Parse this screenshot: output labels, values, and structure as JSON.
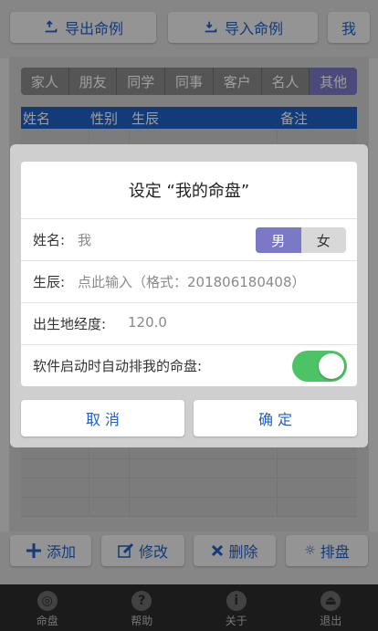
{
  "toolbar": {
    "export_label": "导出命例",
    "import_label": "导入命例",
    "mine_label": "我",
    "export_icon": "hand-export-icon",
    "import_icon": "hand-import-icon"
  },
  "tabs": [
    "家人",
    "朋友",
    "同学",
    "同事",
    "客户",
    "名人",
    "其他"
  ],
  "active_tab": "其他",
  "table": {
    "headers": [
      "姓名",
      "性别",
      "生辰",
      "备注"
    ]
  },
  "actions": {
    "add_label": "添加",
    "edit_label": "修改",
    "delete_label": "删除",
    "arrange_label": "排盘"
  },
  "nav": [
    {
      "label": "命盘",
      "icon": "chart-icon"
    },
    {
      "label": "帮助",
      "icon": "help-icon"
    },
    {
      "label": "关于",
      "icon": "info-icon"
    },
    {
      "label": "退出",
      "icon": "exit-icon"
    }
  ],
  "dialog": {
    "title": "设定 “我的命盘”",
    "name_label": "姓名:",
    "name_value": "我",
    "gender_male": "男",
    "gender_female": "女",
    "gender_selected": "男",
    "birth_label": "生辰:",
    "birth_placeholder": "点此输入（格式：201806180408）",
    "longitude_label": "出生地经度:",
    "longitude_value": "120.0",
    "auto_label": "软件启动时自动排我的命盘:",
    "auto_enabled": true,
    "cancel_label": "取 消",
    "confirm_label": "确 定"
  },
  "colors": {
    "accent_blue": "#1f5fc2",
    "tab_active": "#7b78c6",
    "toggle_on": "#4cc364"
  }
}
